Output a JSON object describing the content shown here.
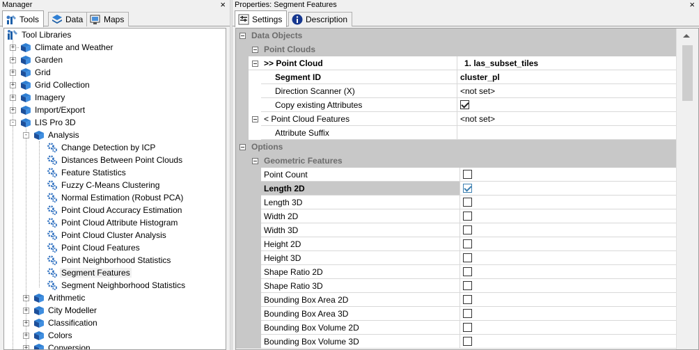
{
  "manager": {
    "title": "Manager",
    "close": "×",
    "tabs": [
      {
        "label": "Tools",
        "icon": "tools-icon",
        "active": true
      },
      {
        "label": "Data",
        "icon": "data-layers-icon",
        "active": false
      },
      {
        "label": "Maps",
        "icon": "maps-icon",
        "active": false
      }
    ],
    "tree": {
      "root": "Tool Libraries",
      "libraries": [
        "Climate and Weather",
        "Garden",
        "Grid",
        "Grid Collection",
        "Imagery",
        "Import/Export",
        "LIS Pro 3D"
      ],
      "sublibrary": "Analysis",
      "tools": [
        "Change Detection by ICP",
        "Distances Between Point Clouds",
        "Feature Statistics",
        "Fuzzy C-Means Clustering",
        "Normal Estimation (Robust PCA)",
        "Point Cloud Accuracy Estimation",
        "Point Cloud Attribute Histogram",
        "Point Cloud Cluster Analysis",
        "Point Cloud Features",
        "Point Neighborhood Statistics",
        "Segment Features",
        "Segment Neighborhood Statistics"
      ],
      "selected_tool": "Segment Features",
      "more_sublibraries": [
        "Arithmetic",
        "City Modeller",
        "Classification",
        "Colors",
        "Conversion"
      ]
    }
  },
  "properties": {
    "title": "Properties: Segment Features",
    "close": "×",
    "tabs": [
      {
        "label": "Settings",
        "icon": "settings-icon",
        "active": true
      },
      {
        "label": "Description",
        "icon": "info-icon",
        "active": false
      }
    ],
    "categories": {
      "data_objects": "Data Objects",
      "point_clouds": "Point Clouds",
      "options": "Options",
      "geometric_features": "Geometric Features"
    },
    "point_cloud": {
      "name": ">> Point Cloud",
      "value": "1. las_subset_tiles"
    },
    "segment_id": {
      "name": "Segment ID",
      "value": "cluster_pl"
    },
    "direction_scanner": {
      "name": "Direction Scanner (X)",
      "value": "<not set>"
    },
    "copy_attributes": {
      "name": "Copy existing Attributes",
      "checked": true
    },
    "point_cloud_features": {
      "name": "< Point Cloud Features",
      "value": "<not set>"
    },
    "attribute_suffix": {
      "name": "Attribute Suffix",
      "value": ""
    },
    "geometric": [
      {
        "name": "Point Count",
        "checked": false,
        "bold": false
      },
      {
        "name": "Length 2D",
        "checked": true,
        "bold": true
      },
      {
        "name": "Length 3D",
        "checked": false,
        "bold": false
      },
      {
        "name": "Width 2D",
        "checked": false,
        "bold": false
      },
      {
        "name": "Width 3D",
        "checked": false,
        "bold": false
      },
      {
        "name": "Height 2D",
        "checked": false,
        "bold": false
      },
      {
        "name": "Height 3D",
        "checked": false,
        "bold": false
      },
      {
        "name": "Shape Ratio 2D",
        "checked": false,
        "bold": false
      },
      {
        "name": "Shape Ratio 3D",
        "checked": false,
        "bold": false
      },
      {
        "name": "Bounding Box Area 2D",
        "checked": false,
        "bold": false
      },
      {
        "name": "Bounding Box Area 3D",
        "checked": false,
        "bold": false
      },
      {
        "name": "Bounding Box Volume 2D",
        "checked": false,
        "bold": false
      },
      {
        "name": "Bounding Box Volume 3D",
        "checked": false,
        "bold": false
      }
    ]
  }
}
